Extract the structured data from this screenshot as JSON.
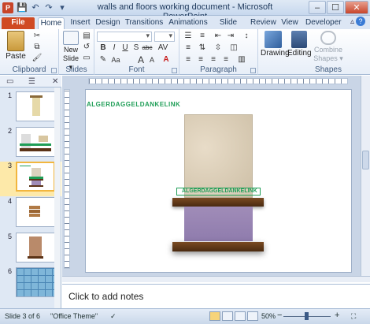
{
  "window": {
    "title": "walls and floors working document  -  Microsoft PowerPoint",
    "minimize": "–",
    "maximize": "☐",
    "close": "✕"
  },
  "qat": [
    "💾",
    "↶",
    "↷",
    "▾"
  ],
  "tabs": [
    "File",
    "Home",
    "Insert",
    "Design",
    "Transitions",
    "Animations",
    "Slide Show",
    "Review",
    "View",
    "Developer"
  ],
  "active_tab": "Home",
  "ribbon": {
    "clipboard": {
      "label": "Clipboard",
      "paste": "Paste"
    },
    "slides": {
      "label": "Slides",
      "new_slide": "New Slide ▾"
    },
    "font": {
      "label": "Font",
      "bold": "B",
      "italic": "I",
      "underline": "U",
      "strike": "S",
      "shadow": "abc",
      "grow": "A",
      "shrink": "A",
      "case": "Aa"
    },
    "paragraph": {
      "label": "Paragraph"
    },
    "drawing": {
      "label": "Drawing"
    },
    "editing": {
      "label": "Editing"
    },
    "shapes": {
      "label": "Shapes",
      "combine": "Combine Shapes ▾"
    }
  },
  "slides": [
    {
      "num": "1"
    },
    {
      "num": "2"
    },
    {
      "num": "3"
    },
    {
      "num": "4"
    },
    {
      "num": "5"
    },
    {
      "num": "6"
    }
  ],
  "selected_slide": 3,
  "slide_content": {
    "top_text": "ALGERDAGGELDANKELINK",
    "box_text": "ALGERDAGGELDANKELINK",
    "colors": {
      "wall_tile": "#d9cdb8",
      "shelf": "#5b3317",
      "purple": "#a08cb8",
      "green": "#1f9e57"
    }
  },
  "notes_placeholder": "Click to add notes",
  "status": {
    "slide": "Slide 3 of 6",
    "theme": "\"Office Theme\"",
    "zoom": "50%",
    "zoom_minus": "−",
    "zoom_plus": "+"
  }
}
